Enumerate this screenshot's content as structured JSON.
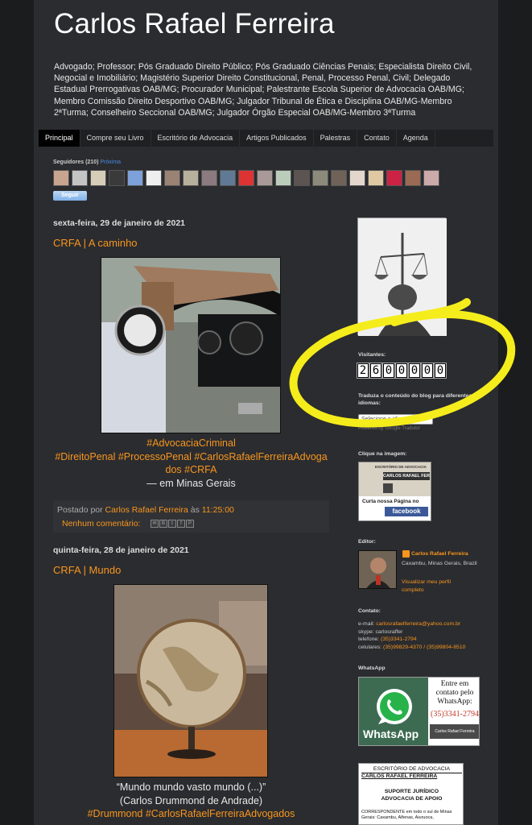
{
  "blog": {
    "title": "Carlos Rafael Ferreira",
    "description": "Advogado; Professor; Pós Graduado Direito Público; Pós Graduado Ciências Penais; Especialista Direito Civil, Negocial e Imobiliário; Magistério Superior Direito Constitucional, Penal, Processo Penal, Civil; Delegado Estadual Prerrogativas OAB/MG; Procurador Municipal; Palestrante Escola Superior de Advocacia OAB/MG; Membro Comissão Direito Desportivo OAB/MG; Julgador Tribunal de Ética e Disciplina OAB/MG-Membro 2ªTurma; Conselheiro Seccional OAB/MG; Julgador Órgão Especial OAB/MG-Membro 3ªTurma"
  },
  "nav": {
    "tabs": [
      "Principal",
      "Compre seu Livro",
      "Escritório de Advocacia",
      "Artigos Publicados",
      "Palestras",
      "Contato",
      "Agenda"
    ]
  },
  "followers": {
    "label": "Seguidores (210)",
    "join": "Próxima",
    "follow_button": "Seguir"
  },
  "posts": [
    {
      "date": "sexta-feira, 29 de janeiro de 2021",
      "title": "CRFA | A caminho",
      "caption_lines": [
        "#AdvocaciaCriminal",
        "#DireitoPenal #ProcessoPenal #CarlosRafaelFerreiraAdvoga",
        "dos #CRFA"
      ],
      "location": "— em Minas Gerais",
      "posted_by_prefix": "Postado por",
      "author": "Carlos Rafael Ferreira",
      "at": "às",
      "time": "11:25:00",
      "comments": "Nenhum comentário:"
    },
    {
      "date": "quinta-feira, 28 de janeiro de 2021",
      "title": "CRFA | Mundo",
      "quote": "“Mundo mundo vasto mundo (...)”",
      "quote_author": "(Carlos Drummond de Andrade)",
      "hashtags": "#Drummond #CarlosRafaelFerreiraAdvogados"
    }
  ],
  "sidebar": {
    "visitors_label": "Visitantes:",
    "visitor_digits": [
      "2",
      "6",
      "0",
      "0",
      "0",
      "0",
      "0"
    ],
    "translate_label": "Traduza o conteúdo do blog para diferentes idiomas:",
    "translate_select": "Selecione o idioma",
    "powered_by": "Powered by Google Tradutor",
    "facebook_label": "Clique na imagem:",
    "facebook_banner_top": "ESCRITÓRIO DE ADVOCACIA",
    "facebook_banner_name": "CARLOS RAFAEL FERRE",
    "facebook_cta": "Curta nossa Página no",
    "facebook_brand": "facebook",
    "editor_label": "Editor:",
    "editor_name": "Carlos Rafael Ferreira",
    "editor_location": "Caxambu, Minas Gerais, Brazil",
    "editor_profile_link": "Visualizar meu perfil completo",
    "contact_label": "Contato:",
    "contact_email_prefix": "e-mail:",
    "contact_email": "carlosrafaelferreira@yahoo.com.br",
    "contact_skype": "skype: carlosraffer",
    "contact_phone_prefix": "telefone:",
    "contact_phone": "(35)3341-2794",
    "contact_cell_prefix": "celulares:",
    "contact_cell": "(35)99829-4370 / (35)99804-8510",
    "whatsapp_label": "WhatsApp",
    "whatsapp_text": "Entre em contato pelo WhatsApp:",
    "whatsapp_number": "(35)3341-2794",
    "whatsapp_brand": "WhatsApp",
    "whatsapp_firm": "Carlos Rafael Ferreira",
    "office_header": "ESCRITÓRIO DE ADVOCACIA",
    "office_name": "CARLOS RAFAEL FERREIRA",
    "office_support": "SUPORTE JURÍDICO",
    "office_support2": "ADVOCACIA DE APOIO",
    "office_corr": "CORRESPONDENTE em todo o sul de Minas Gerais: Caxambu, Alfenas, Aiuruoca,"
  },
  "colors": {
    "accent": "#f8961e",
    "highlight": "#f5ec1c"
  }
}
